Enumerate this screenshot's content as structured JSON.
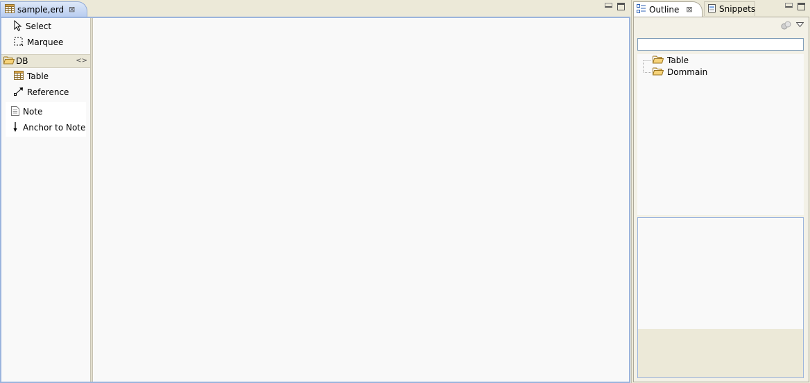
{
  "editor": {
    "tab_title": "sample,erd"
  },
  "palette": {
    "select_label": "Select",
    "marquee_label": "Marquee",
    "drawer_label": "DB",
    "table_label": "Table",
    "reference_label": "Reference",
    "note_label": "Note",
    "anchor_label": "Anchor to Note"
  },
  "outline": {
    "tab_outline": "Outline",
    "tab_snippets": "Snippets",
    "tree": [
      {
        "label": "Table",
        "icon": "folder-icon"
      },
      {
        "label": "Dommain",
        "icon": "folder-icon"
      }
    ]
  },
  "colors": {
    "tab_active": "#b9cdf0",
    "frame_border": "#9bb4dd",
    "background": "#ece9d8",
    "canvas": "#f9f9f9",
    "folder": "#e6b84a"
  }
}
